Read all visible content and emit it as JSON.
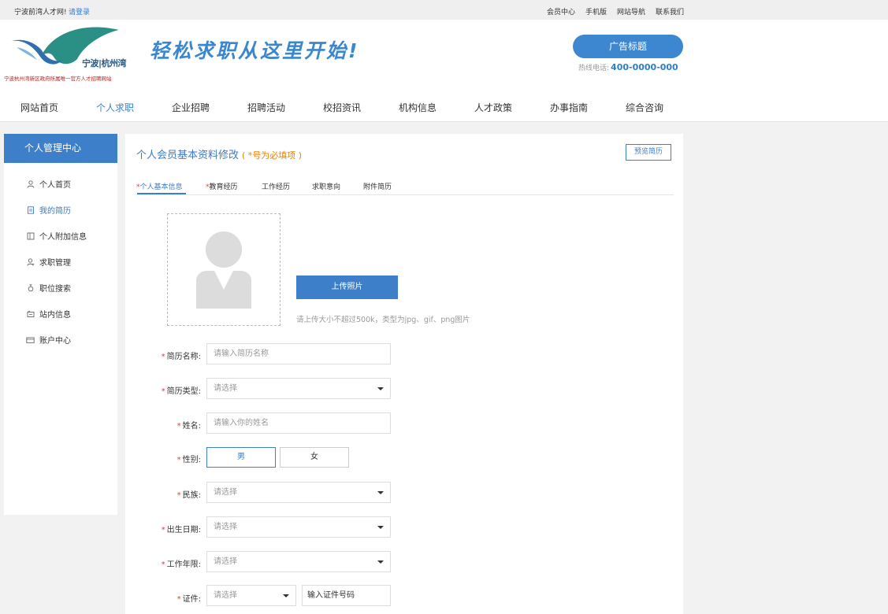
{
  "topbar": {
    "welcome": "宁波前湾人才网!",
    "login": "请登录",
    "links": [
      "会员中心",
      "手机版",
      "网站导航",
      "联系我们"
    ]
  },
  "header": {
    "logo_name": "宁波|杭州湾",
    "logo_sub": "宁波杭州湾新区政府所属唯一官方人才招聘网站",
    "slogan": "轻松求职从这里开始!",
    "ad_button": "广告标题",
    "hotline_label": "热线电话:",
    "hotline_number": "400-0000-000"
  },
  "nav": {
    "items": [
      "网站首页",
      "个人求职",
      "企业招聘",
      "招聘活动",
      "校招资讯",
      "机构信息",
      "人才政策",
      "办事指南",
      "综合咨询"
    ],
    "active": "个人求职"
  },
  "sidebar": {
    "title": "个人管理中心",
    "items": [
      {
        "label": "个人首页",
        "icon": "user-icon"
      },
      {
        "label": "我的简历",
        "icon": "resume-icon"
      },
      {
        "label": "个人附加信息",
        "icon": "info-icon"
      },
      {
        "label": "求职管理",
        "icon": "user-manage-icon"
      },
      {
        "label": "职位搜索",
        "icon": "search-job-icon"
      },
      {
        "label": "站内信息",
        "icon": "message-icon"
      },
      {
        "label": "账户中心",
        "icon": "account-icon"
      }
    ],
    "active": "我的简历"
  },
  "main": {
    "title": "个人会员基本资料修改",
    "required_note": "( *号为必填项 )",
    "preview_button": "预览简历",
    "tabs": [
      {
        "label": "个人基本信息",
        "required": true
      },
      {
        "label": "教育经历",
        "required": true
      },
      {
        "label": "工作经历",
        "required": false
      },
      {
        "label": "求职意向",
        "required": false
      },
      {
        "label": "附件简历",
        "required": false
      }
    ],
    "upload_button": "上传照片",
    "upload_hint": "请上传大小不超过500k，类型为jpg、gif、png图片",
    "form": {
      "resume_name": {
        "label": "简历名称:",
        "placeholder": "请输入简历名称"
      },
      "resume_type": {
        "label": "简历类型:",
        "value": "请选择"
      },
      "name": {
        "label": "姓名:",
        "placeholder": "请输入你的姓名"
      },
      "gender": {
        "label": "性别:",
        "options": [
          "男",
          "女"
        ],
        "selected": "男"
      },
      "ethnicity": {
        "label": "民族:",
        "value": "请选择"
      },
      "birth_date": {
        "label": "出生日期:",
        "value": "请选择"
      },
      "work_years": {
        "label": "工作年限:",
        "value": "请选择"
      },
      "certificate": {
        "label": "证件:",
        "value": "请选择",
        "number_placeholder": "输入证件号码"
      }
    }
  },
  "colors": {
    "primary": "#3d7fc9",
    "required_star": "#e03c3c",
    "note_orange": "#e8820c"
  }
}
